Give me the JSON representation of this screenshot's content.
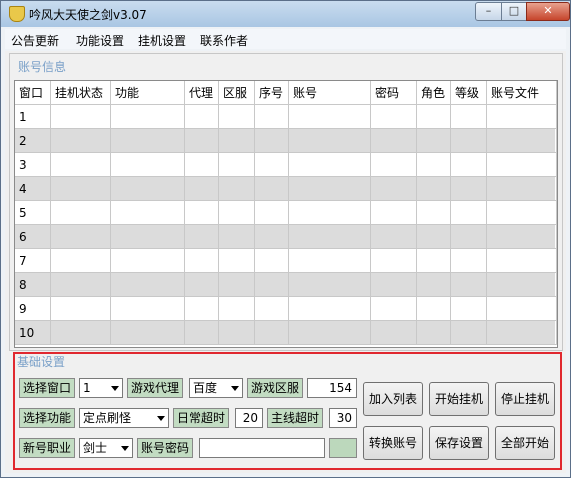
{
  "window": {
    "title": "吟风大天使之剑v3.07",
    "min_icon": "minimize-icon",
    "max_icon": "maximize-icon",
    "close_icon": "close-icon",
    "app_icon": "shield-icon"
  },
  "menu": [
    "公告更新",
    "功能设置",
    "挂机设置",
    "联系作者"
  ],
  "accounts": {
    "title": "账号信息",
    "columns": [
      "窗口",
      "挂机状态",
      "功能",
      "代理",
      "区服",
      "序号",
      "账号",
      "密码",
      "角色",
      "等级",
      "账号文件"
    ],
    "rows": [
      "1",
      "2",
      "3",
      "4",
      "5",
      "6",
      "7",
      "8",
      "9",
      "10"
    ]
  },
  "basic": {
    "title": "基础设置",
    "select_window_label": "选择窗口",
    "select_window_value": "1",
    "game_proxy_label": "游戏代理",
    "game_proxy_value": "百度",
    "game_server_label": "游戏区服",
    "game_server_value": "154",
    "select_function_label": "选择功能",
    "select_function_value": "定点刷怪",
    "daily_timeout_label": "日常超时",
    "daily_timeout_value": "20",
    "main_timeout_label": "主线超时",
    "main_timeout_value": "30",
    "new_job_label": "新号职业",
    "new_job_value": "剑士",
    "account_pwd_label": "账号密码",
    "account_pwd_value": "",
    "buttons": {
      "add_list": "加入列表",
      "start_hang": "开始挂机",
      "stop_hang": "停止挂机",
      "switch_account": "转换账号",
      "save_settings": "保存设置",
      "start_all": "全部开始"
    }
  },
  "colors": {
    "highlight_border": "#e0282f",
    "label_green": "#c2dcc2",
    "group_title": "#7aa0c8"
  }
}
